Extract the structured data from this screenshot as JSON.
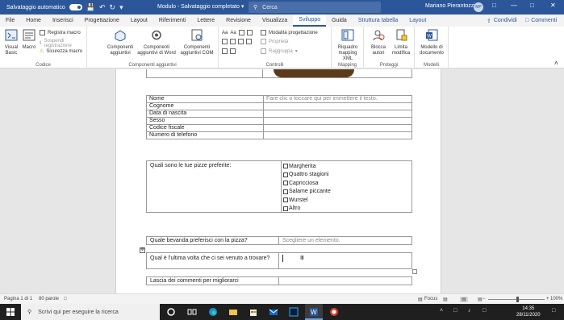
{
  "titlebar": {
    "autosave_label": "Salvataggio automatico",
    "doc_title": "Modulo - Salvataggio completato",
    "search_placeholder": "Cerca",
    "user_name": "Mariano Pierantozzi",
    "user_initials": "MP"
  },
  "tabs": [
    "File",
    "Home",
    "Inserisci",
    "Progettazione",
    "Layout",
    "Riferimenti",
    "Lettere",
    "Revisione",
    "Visualizza",
    "Sviluppo",
    "Guida",
    "Struttura tabella",
    "Layout"
  ],
  "active_tab": "Sviluppo",
  "share_label": "Condividi",
  "comments_label": "Commenti",
  "ribbon": {
    "codice": {
      "label": "Codice",
      "visual_basic": "Visual Basic",
      "macro": "Macro",
      "registra": "Registra macro",
      "sospendi": "Sospendi registrazione",
      "sicurezza": "Sicurezza macro"
    },
    "componenti": {
      "label": "Componenti aggiuntivi",
      "c1": "Componenti aggiuntivi",
      "c2": "Componenti aggiuntivi di Word",
      "c3": "Componenti aggiuntivi COM"
    },
    "controlli": {
      "label": "Controlli",
      "modalita": "Modalità progettazione",
      "proprieta": "Proprietà",
      "raggruppa": "Raggruppa"
    },
    "mapping": {
      "label": "Mapping",
      "riquadro": "Riquadro mapping XML"
    },
    "proteggi": {
      "label": "Proteggi",
      "blocca": "Blocca autori",
      "limita": "Limita modifica"
    },
    "modelli": {
      "label": "Modelli",
      "modello": "Modello di documento"
    }
  },
  "form": {
    "fields": [
      "Nome",
      "Cognome",
      "Data di nascita",
      "Sesso",
      "Codice fiscale",
      "Numero di telefono"
    ],
    "name_placeholder": "Fare clic o toccare qui per immettere il testo.",
    "pizza_question": "Quali sono le tue pizze preferite:",
    "pizzas": [
      "Margherita",
      "Quattro stagioni",
      "Capricciosa",
      "Salame piccante",
      "Wurstel",
      "Altro"
    ],
    "drink_question": "Quale bevanda preferisci con la pizza?",
    "drink_placeholder": "Scegliere un elemento.",
    "last_time_question": "Qual è l'ultima volta che ci sei venuto a trovare?",
    "comments_label": "Lascia dei commenti per migliorarci"
  },
  "statusbar": {
    "page": "Pagina 1 di 1",
    "words": "80 parole",
    "focus": "Focus",
    "zoom": "100%"
  },
  "taskbar": {
    "search_placeholder": "Scrivi qui per eseguire la ricerca",
    "time": "14:35",
    "date": "28/11/2020"
  },
  "colors": {
    "word_blue": "#2b579a"
  }
}
